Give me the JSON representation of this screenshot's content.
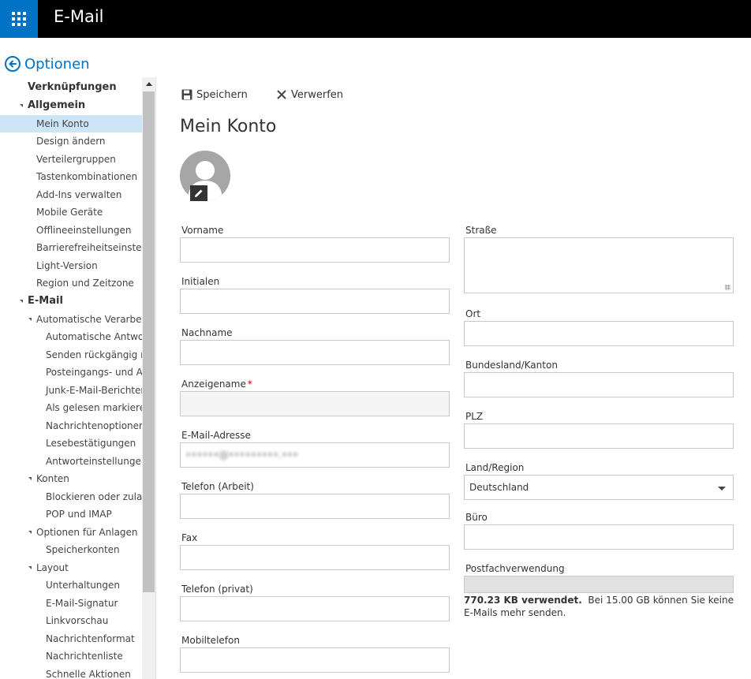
{
  "header": {
    "app_title": "E-Mail",
    "brand_color": "#0072c6"
  },
  "options": {
    "title": "Optionen"
  },
  "sidebar": {
    "items": [
      {
        "label": "Verknüpfungen",
        "level": 0,
        "bold": true,
        "expander": false
      },
      {
        "label": "Allgemein",
        "level": 0,
        "bold": true,
        "expander": true
      },
      {
        "label": "Mein Konto",
        "level": 1,
        "selected": true
      },
      {
        "label": "Design ändern",
        "level": 1
      },
      {
        "label": "Verteilergruppen",
        "level": 1
      },
      {
        "label": "Tastenkombinationen",
        "level": 1
      },
      {
        "label": "Add-Ins verwalten",
        "level": 1
      },
      {
        "label": "Mobile Geräte",
        "level": 1
      },
      {
        "label": "Offlineeinstellungen",
        "level": 1
      },
      {
        "label": "Barrierefreiheitseinstellungen",
        "level": 1
      },
      {
        "label": "Light-Version",
        "level": 1
      },
      {
        "label": "Region und Zeitzone",
        "level": 1
      },
      {
        "label": "E-Mail",
        "level": 0,
        "bold": true,
        "expander": true
      },
      {
        "label": "Automatische Verarbeitung",
        "level": 1,
        "expander": true
      },
      {
        "label": "Automatische Antworten",
        "level": 2
      },
      {
        "label": "Senden rückgängig machen",
        "level": 2
      },
      {
        "label": "Posteingangs- und Aufräumregeln",
        "level": 2
      },
      {
        "label": "Junk-E-Mail-Berichterstattung",
        "level": 2
      },
      {
        "label": "Als gelesen markieren",
        "level": 2
      },
      {
        "label": "Nachrichtenoptionen",
        "level": 2
      },
      {
        "label": "Lesebestätigungen",
        "level": 2
      },
      {
        "label": "Antworteinstellungen",
        "level": 2
      },
      {
        "label": "Konten",
        "level": 1,
        "expander": true
      },
      {
        "label": "Blockieren oder zulassen",
        "level": 2
      },
      {
        "label": "POP und IMAP",
        "level": 2
      },
      {
        "label": "Optionen für Anlagen",
        "level": 1,
        "expander": true
      },
      {
        "label": "Speicherkonten",
        "level": 2
      },
      {
        "label": "Layout",
        "level": 1,
        "expander": true
      },
      {
        "label": "Unterhaltungen",
        "level": 2
      },
      {
        "label": "E-Mail-Signatur",
        "level": 2
      },
      {
        "label": "Linkvorschau",
        "level": 2
      },
      {
        "label": "Nachrichtenformat",
        "level": 2
      },
      {
        "label": "Nachrichtenliste",
        "level": 2
      },
      {
        "label": "Schnelle Aktionen",
        "level": 2
      }
    ]
  },
  "toolbar": {
    "save_label": "Speichern",
    "discard_label": "Verwerfen"
  },
  "page": {
    "title": "Mein Konto"
  },
  "form": {
    "first_name": {
      "label": "Vorname",
      "value": ""
    },
    "initials": {
      "label": "Initialen",
      "value": ""
    },
    "last_name": {
      "label": "Nachname",
      "value": ""
    },
    "display_name": {
      "label": "Anzeigename",
      "required_mark": "*",
      "value": ""
    },
    "email": {
      "label": "E-Mail-Adresse",
      "value": "••••••@•••••••••.•••"
    },
    "phone_work": {
      "label": "Telefon (Arbeit)",
      "value": ""
    },
    "fax": {
      "label": "Fax",
      "value": ""
    },
    "phone_private": {
      "label": "Telefon (privat)",
      "value": ""
    },
    "mobile": {
      "label": "Mobiltelefon",
      "value": ""
    },
    "street": {
      "label": "Straße",
      "value": ""
    },
    "city": {
      "label": "Ort",
      "value": ""
    },
    "state": {
      "label": "Bundesland/Kanton",
      "value": ""
    },
    "zip": {
      "label": "PLZ",
      "value": ""
    },
    "country": {
      "label": "Land/Region",
      "value": "Deutschland"
    },
    "office": {
      "label": "Büro",
      "value": ""
    },
    "mailbox_usage": {
      "label": "Postfachverwendung",
      "used_text": "770.23 KB verwendet.",
      "limit_text": "Bei 15.00 GB können Sie keine E-Mails mehr senden.",
      "used_fraction": 0.0001
    }
  }
}
